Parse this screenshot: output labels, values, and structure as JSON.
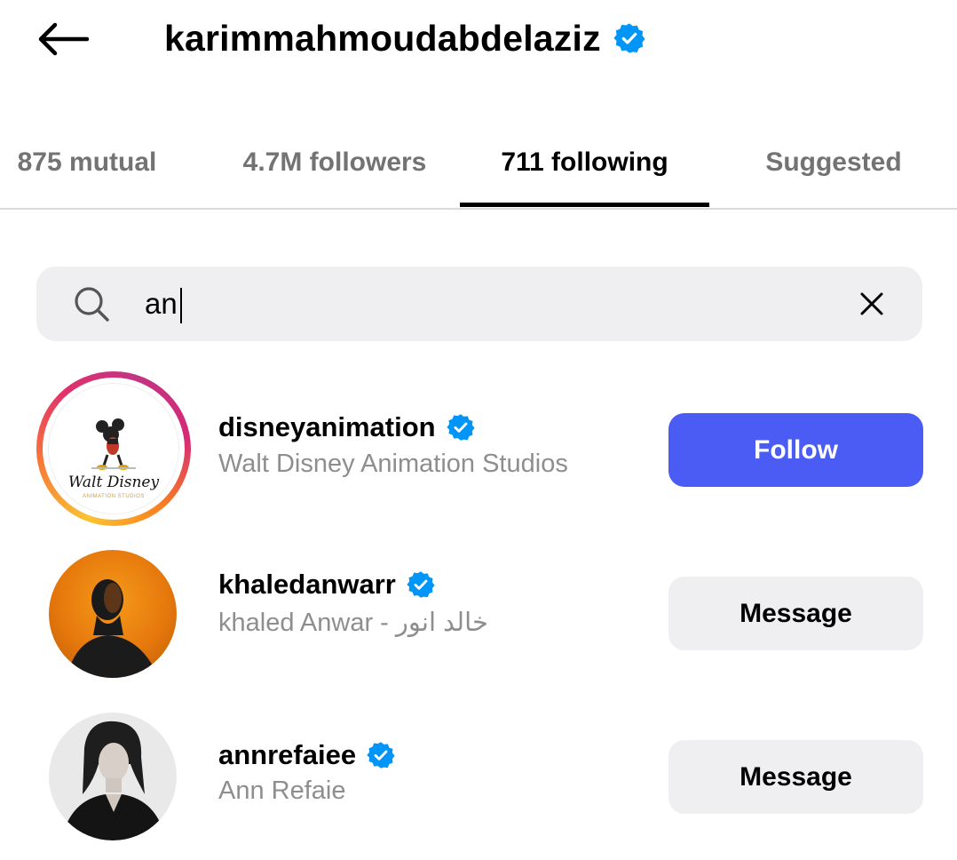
{
  "header": {
    "username": "karimmahmoudabdelaziz",
    "verified": true,
    "back_icon": "arrow-left-icon"
  },
  "tabs": [
    {
      "label": "875 mutual",
      "active": false
    },
    {
      "label": "4.7M followers",
      "active": false
    },
    {
      "label": "711 following",
      "active": true
    },
    {
      "label": "Suggested",
      "active": false
    }
  ],
  "search": {
    "value": "an",
    "icon": "search-icon",
    "clear_icon": "close-icon"
  },
  "results": [
    {
      "username": "disneyanimation",
      "fullname": "Walt Disney Animation Studios",
      "verified": true,
      "has_story_ring": true,
      "button_label": "Follow",
      "button_type": "primary",
      "logo_text": "Walt Disney",
      "logo_subtext": "ANIMATION STUDIOS"
    },
    {
      "username": "khaledanwarr",
      "fullname": "khaled Anwar - خالد انور",
      "verified": true,
      "has_story_ring": false,
      "button_label": "Message",
      "button_type": "secondary"
    },
    {
      "username": "annrefaiee",
      "fullname": "Ann Refaie",
      "verified": true,
      "has_story_ring": false,
      "button_label": "Message",
      "button_type": "secondary"
    }
  ],
  "colors": {
    "follow_button": "#4b5cf5",
    "message_button": "#efeff2",
    "verified_badge": "#0095f6",
    "muted_text": "#8e8e8e"
  }
}
